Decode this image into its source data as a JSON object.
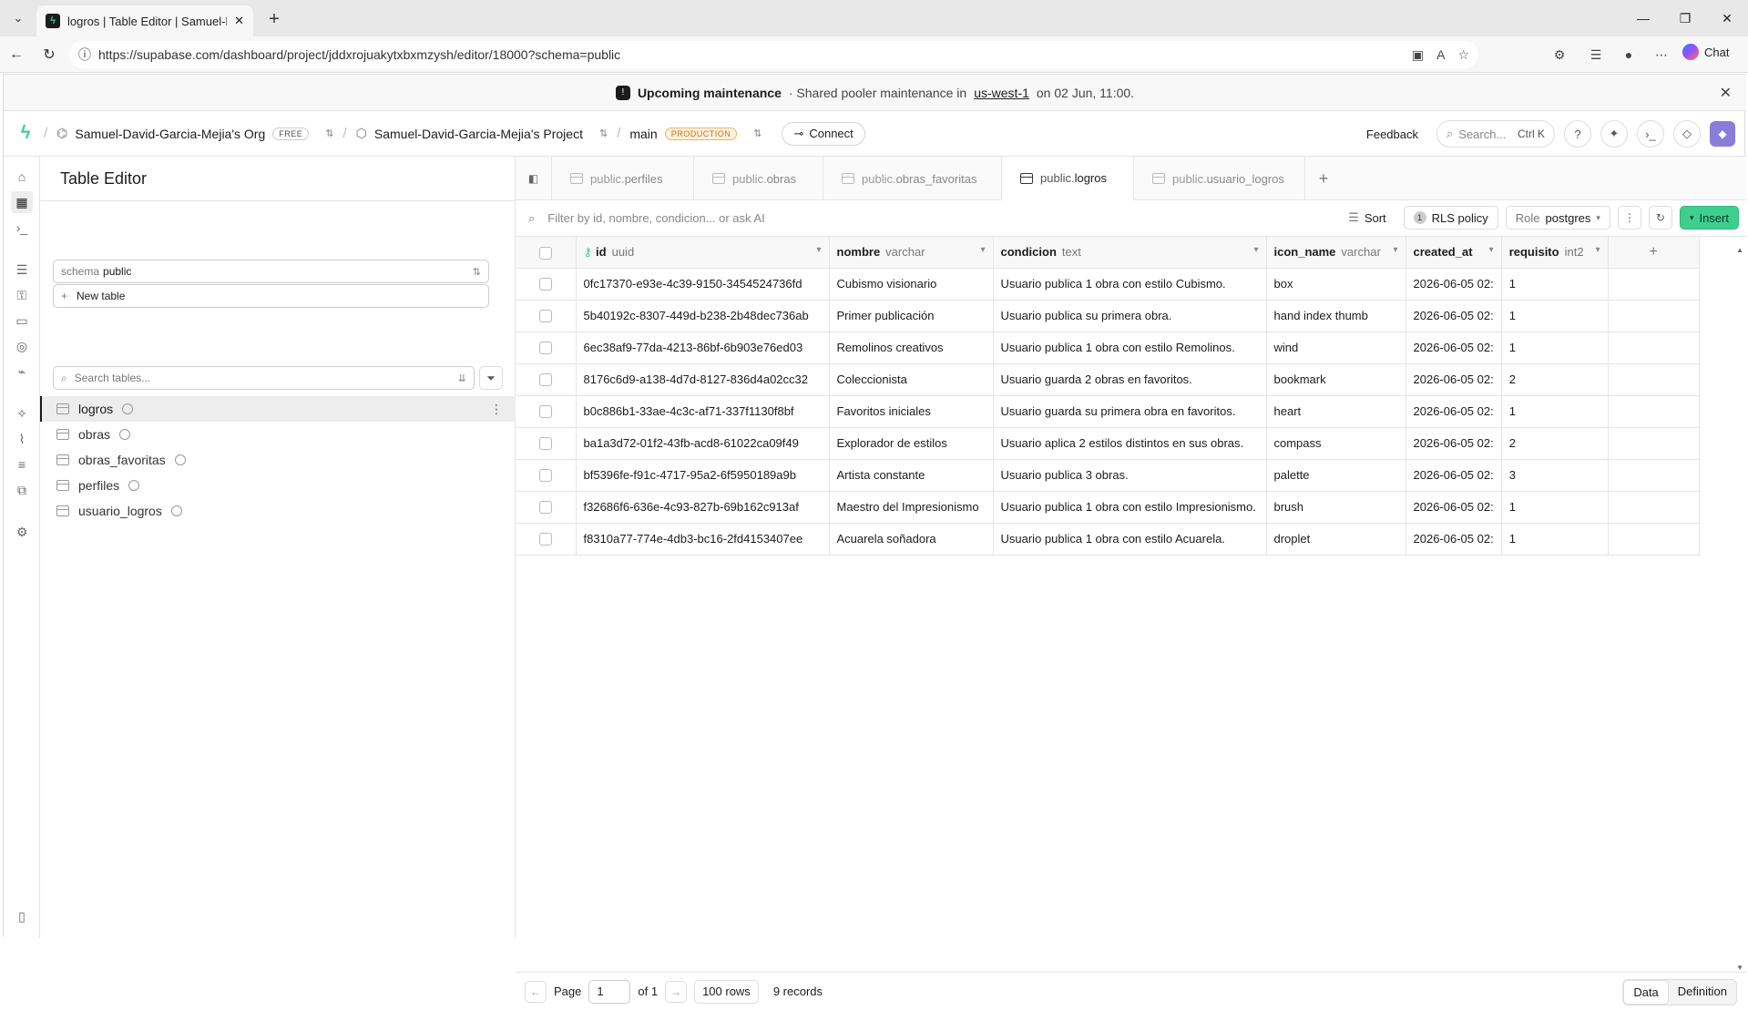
{
  "browser": {
    "tab_title": "logros | Table Editor | Samuel-Davi",
    "url": "https://supabase.com/dashboard/project/jddxrojuakytxbxmzysh/editor/18000?schema=public",
    "chat_label": "Chat"
  },
  "banner": {
    "title": "Upcoming maintenance",
    "text_prefix": "· Shared pooler maintenance in",
    "region": "us-west-1",
    "text_suffix": "on 02 Jun, 11:00."
  },
  "topbar": {
    "org": "Samuel-David-Garcia-Mejia's Org",
    "org_badge": "FREE",
    "project": "Samuel-David-Garcia-Mejia's Project",
    "branch": "main",
    "branch_badge": "PRODUCTION",
    "connect": "Connect",
    "feedback": "Feedback",
    "search_placeholder": "Search...",
    "search_shortcut": "Ctrl K"
  },
  "side": {
    "title": "Table Editor",
    "schema_label": "schema",
    "schema_value": "public",
    "new_table": "New table",
    "search_placeholder": "Search tables...",
    "tables": [
      "logros",
      "obras",
      "obras_favoritas",
      "perfiles",
      "usuario_logros"
    ]
  },
  "tabs": [
    {
      "schema": "public.",
      "name": "perfiles"
    },
    {
      "schema": "public.",
      "name": "obras"
    },
    {
      "schema": "public.",
      "name": "obras_favoritas"
    },
    {
      "schema": "public.",
      "name": "logros"
    },
    {
      "schema": "public.",
      "name": "usuario_logros"
    }
  ],
  "toolbar": {
    "filter_placeholder": "Filter by id, nombre, condicion... or ask AI",
    "sort": "Sort",
    "rls_count": "1",
    "rls": "RLS policy",
    "role_label": "Role",
    "role_value": "postgres",
    "insert": "Insert"
  },
  "grid": {
    "columns": [
      {
        "name": "id",
        "type": "uuid"
      },
      {
        "name": "nombre",
        "type": "varchar"
      },
      {
        "name": "condicion",
        "type": "text"
      },
      {
        "name": "icon_name",
        "type": "varchar"
      },
      {
        "name": "created_at",
        "type": ""
      },
      {
        "name": "requisito",
        "type": "int2"
      }
    ],
    "rows": [
      [
        "0fc17370-e93e-4c39-9150-3454524736fd",
        "Cubismo visionario",
        "Usuario publica 1 obra con estilo Cubismo.",
        "box",
        "2026-06-05 02:",
        "1"
      ],
      [
        "5b40192c-8307-449d-b238-2b48dec736ab",
        "Primer publicación",
        "Usuario publica su primera obra.",
        "hand index thumb",
        "2026-06-05 02:",
        "1"
      ],
      [
        "6ec38af9-77da-4213-86bf-6b903e76ed03",
        "Remolinos creativos",
        "Usuario publica 1 obra con estilo Remolinos.",
        "wind",
        "2026-06-05 02:",
        "1"
      ],
      [
        "8176c6d9-a138-4d7d-8127-836d4a02cc32",
        "Coleccionista",
        "Usuario guarda 2 obras en favoritos.",
        "bookmark",
        "2026-06-05 02:",
        "2"
      ],
      [
        "b0c886b1-33ae-4c3c-af71-337f1130f8bf",
        "Favoritos iniciales",
        "Usuario guarda su primera obra en favoritos.",
        "heart",
        "2026-06-05 02:",
        "1"
      ],
      [
        "ba1a3d72-01f2-43fb-acd8-61022ca09f49",
        "Explorador de estilos",
        "Usuario aplica 2 estilos distintos en sus obras.",
        "compass",
        "2026-06-05 02:",
        "2"
      ],
      [
        "bf5396fe-f91c-4717-95a2-6f5950189a9b",
        "Artista constante",
        "Usuario publica 3 obras.",
        "palette",
        "2026-06-05 02:",
        "3"
      ],
      [
        "f32686f6-636e-4c93-827b-69b162c913af",
        "Maestro del Impresionismo",
        "Usuario publica 1 obra con estilo Impresionismo.",
        "brush",
        "2026-06-05 02:",
        "1"
      ],
      [
        "f8310a77-774e-4db3-bc16-2fd4153407ee",
        "Acuarela soñadora",
        "Usuario publica 1 obra con estilo Acuarela.",
        "droplet",
        "2026-06-05 02:",
        "1"
      ]
    ]
  },
  "footer": {
    "page_label": "Page",
    "page_value": "1",
    "of_label": "of 1",
    "rows_per_page": "100 rows",
    "records": "9 records",
    "view_data": "Data",
    "view_definition": "Definition"
  },
  "colors": {
    "accent": "#3ecf8e",
    "production": "#c27317"
  }
}
